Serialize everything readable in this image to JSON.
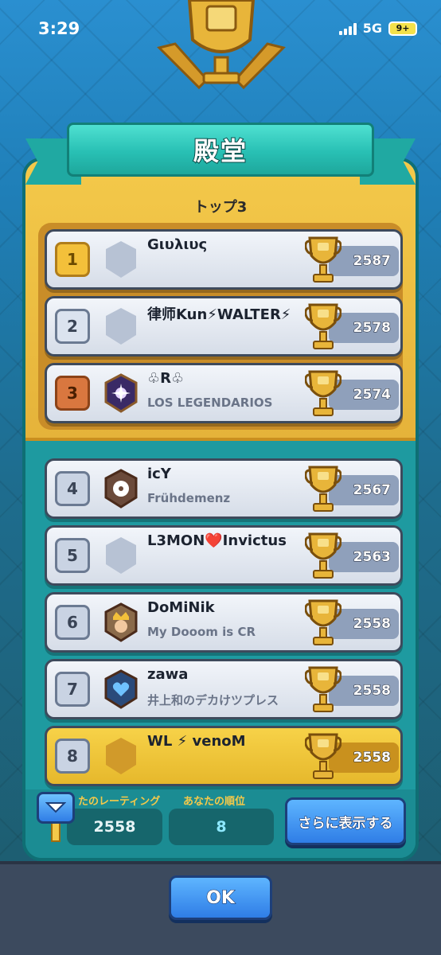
{
  "status_bar": {
    "time": "3:29",
    "network": "5G",
    "battery": "9+"
  },
  "header": {
    "title": "殿堂"
  },
  "top3_label": "トップ3",
  "rows": [
    {
      "rank": "1",
      "name": "Gιυλιυς",
      "clan": "",
      "trophies": "2587",
      "badge": "empty-badge-icon"
    },
    {
      "rank": "2",
      "name": "律师Kun⚡WALTER⚡",
      "clan": "",
      "trophies": "2578",
      "badge": "empty-badge-icon"
    },
    {
      "rank": "3",
      "name": "♧R♧",
      "clan": "LOS LEGENDARIOS",
      "trophies": "2574",
      "badge": "purple-star-badge-icon"
    },
    {
      "rank": "4",
      "name": "icY",
      "clan": "Frühdemenz",
      "trophies": "2567",
      "badge": "flower-badge-icon"
    },
    {
      "rank": "5",
      "name": "L3MON❤️Invictus",
      "clan": "",
      "trophies": "2563",
      "badge": "empty-badge-icon"
    },
    {
      "rank": "6",
      "name": "DoMiNik",
      "clan": "My Dooom is CR",
      "trophies": "2558",
      "badge": "king-badge-icon"
    },
    {
      "rank": "7",
      "name": "zawa",
      "clan": "井上和のデカけツプレス",
      "trophies": "2558",
      "badge": "heart-badge-icon"
    },
    {
      "rank": "8",
      "name": "WL ⚡ venoM",
      "clan": "",
      "trophies": "2558",
      "badge": "empty-badge-icon"
    }
  ],
  "footer": {
    "rating_label": "たのレーティング",
    "rating_value": "2558",
    "rank_label": "あなたの順位",
    "rank_value": "8",
    "show_more": "さらに表示する"
  },
  "ok_label": "OK",
  "colors": {
    "gold": "#f3c03a",
    "teal": "#1e9aa0",
    "blue_button": "#2f7de6"
  }
}
